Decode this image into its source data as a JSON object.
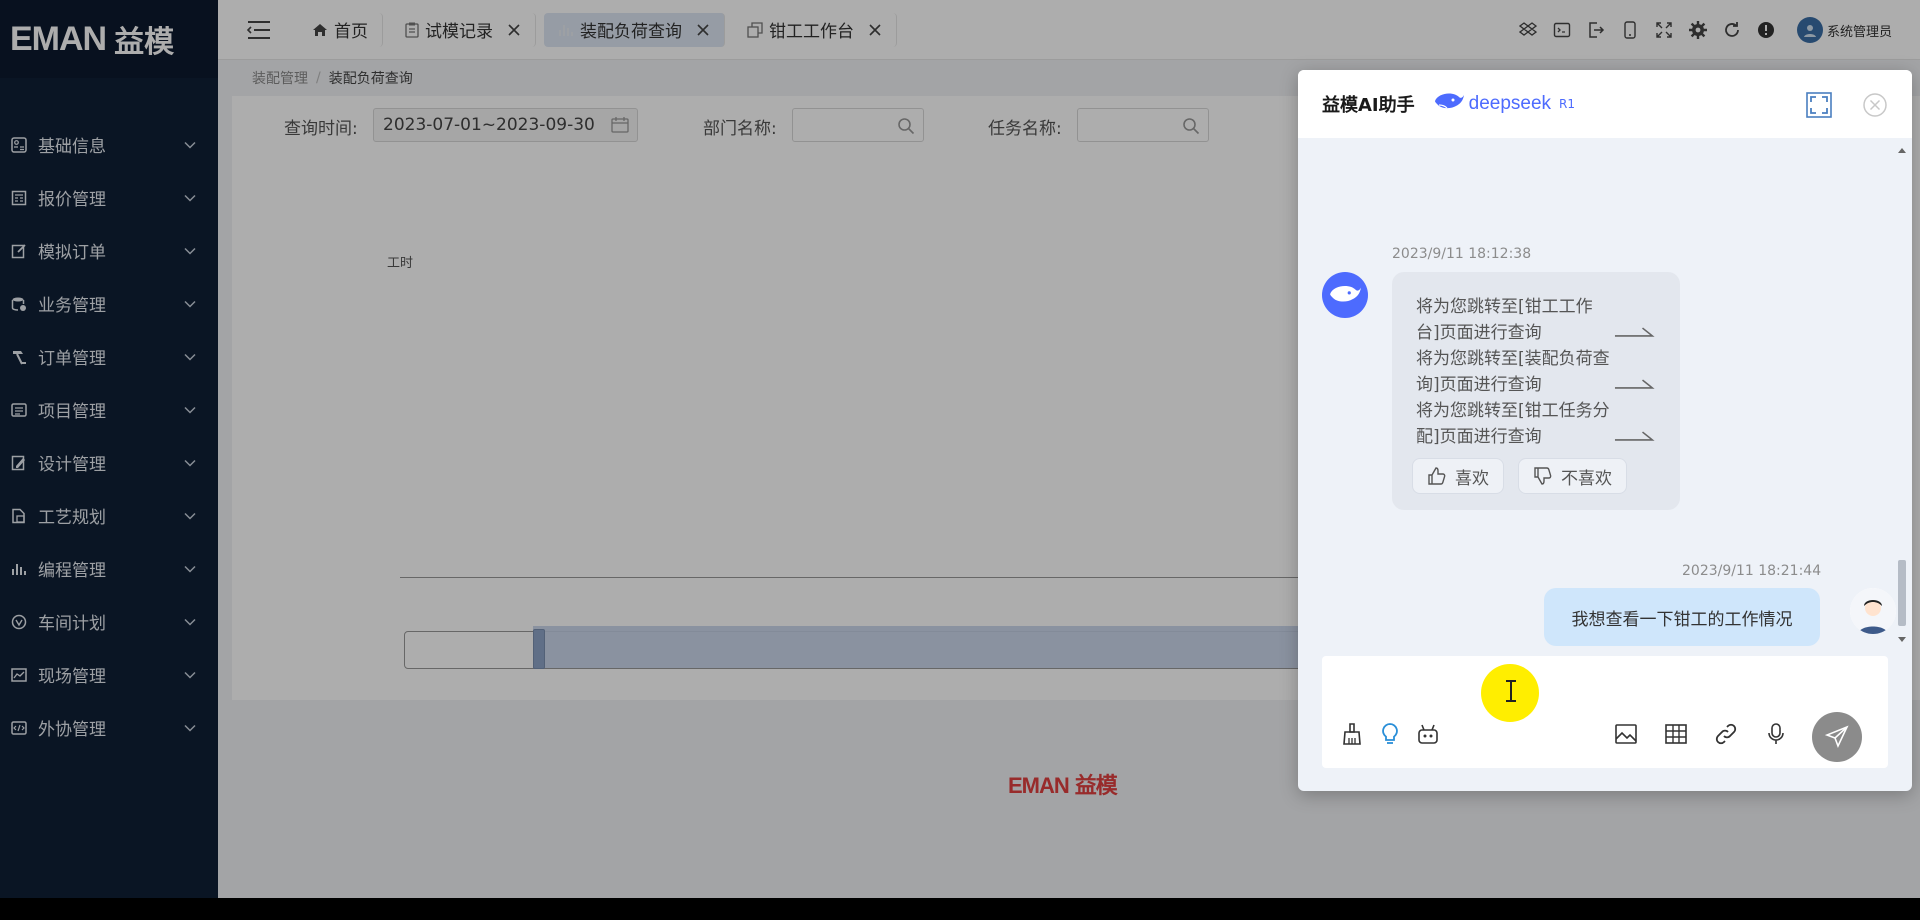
{
  "app": {
    "logo_en": "EMAN",
    "logo_cn": "益模"
  },
  "sidebar": {
    "items": [
      {
        "label": "基础信息",
        "icon": "grid-icon"
      },
      {
        "label": "报价管理",
        "icon": "calculator-icon"
      },
      {
        "label": "模拟订单",
        "icon": "edit-icon"
      },
      {
        "label": "业务管理",
        "icon": "database-icon"
      },
      {
        "label": "订单管理",
        "icon": "hammer-icon"
      },
      {
        "label": "项目管理",
        "icon": "list-icon"
      },
      {
        "label": "设计管理",
        "icon": "pencil-icon"
      },
      {
        "label": "工艺规划",
        "icon": "document-icon"
      },
      {
        "label": "编程管理",
        "icon": "bar-chart-icon"
      },
      {
        "label": "车间计划",
        "icon": "gauge-icon"
      },
      {
        "label": "现场管理",
        "icon": "image-icon"
      },
      {
        "label": "外协管理",
        "icon": "code-icon"
      }
    ]
  },
  "tabs": [
    {
      "label": "首页",
      "icon": "home-icon",
      "closable": false,
      "active": false
    },
    {
      "label": "试模记录",
      "icon": "clipboard-icon",
      "closable": true,
      "active": false
    },
    {
      "label": "装配负荷查询",
      "icon": "bar-chart-icon",
      "closable": true,
      "active": true
    },
    {
      "label": "钳工工作台",
      "icon": "copy-icon",
      "closable": true,
      "active": false
    }
  ],
  "topbar": {
    "user_name": "系统管理员"
  },
  "breadcrumb": {
    "parent": "装配管理",
    "separator": "/",
    "current": "装配负荷查询"
  },
  "query": {
    "time_label": "查询时间:",
    "time_value": "2023-07-01~2023-09-30",
    "dept_label": "部门名称:",
    "dept_value": "",
    "task_label": "任务名称:",
    "task_value": ""
  },
  "chart": {
    "ylabel": "工时"
  },
  "footer": {
    "logo_en": "EMAN",
    "logo_cn": "益模"
  },
  "chat": {
    "title": "益模AI助手",
    "model_name": "deepseek",
    "model_version": "R1",
    "bot_timestamp": "2023/9/11 18:12:38",
    "jumps": [
      "将为您跳转至[钳工工作台]页面进行查询",
      "将为您跳转至[装配负荷查询]页面进行查询",
      "将为您跳转至[钳工任务分配]页面进行查询"
    ],
    "like_label": "喜欢",
    "dislike_label": "不喜欢",
    "user_timestamp": "2023/9/11 18:21:44",
    "user_message": "我想查看一下钳工的工作情况",
    "input_value": "",
    "colors": {
      "accent": "#4d6bfe",
      "user_bubble": "#cfe6fb"
    }
  }
}
